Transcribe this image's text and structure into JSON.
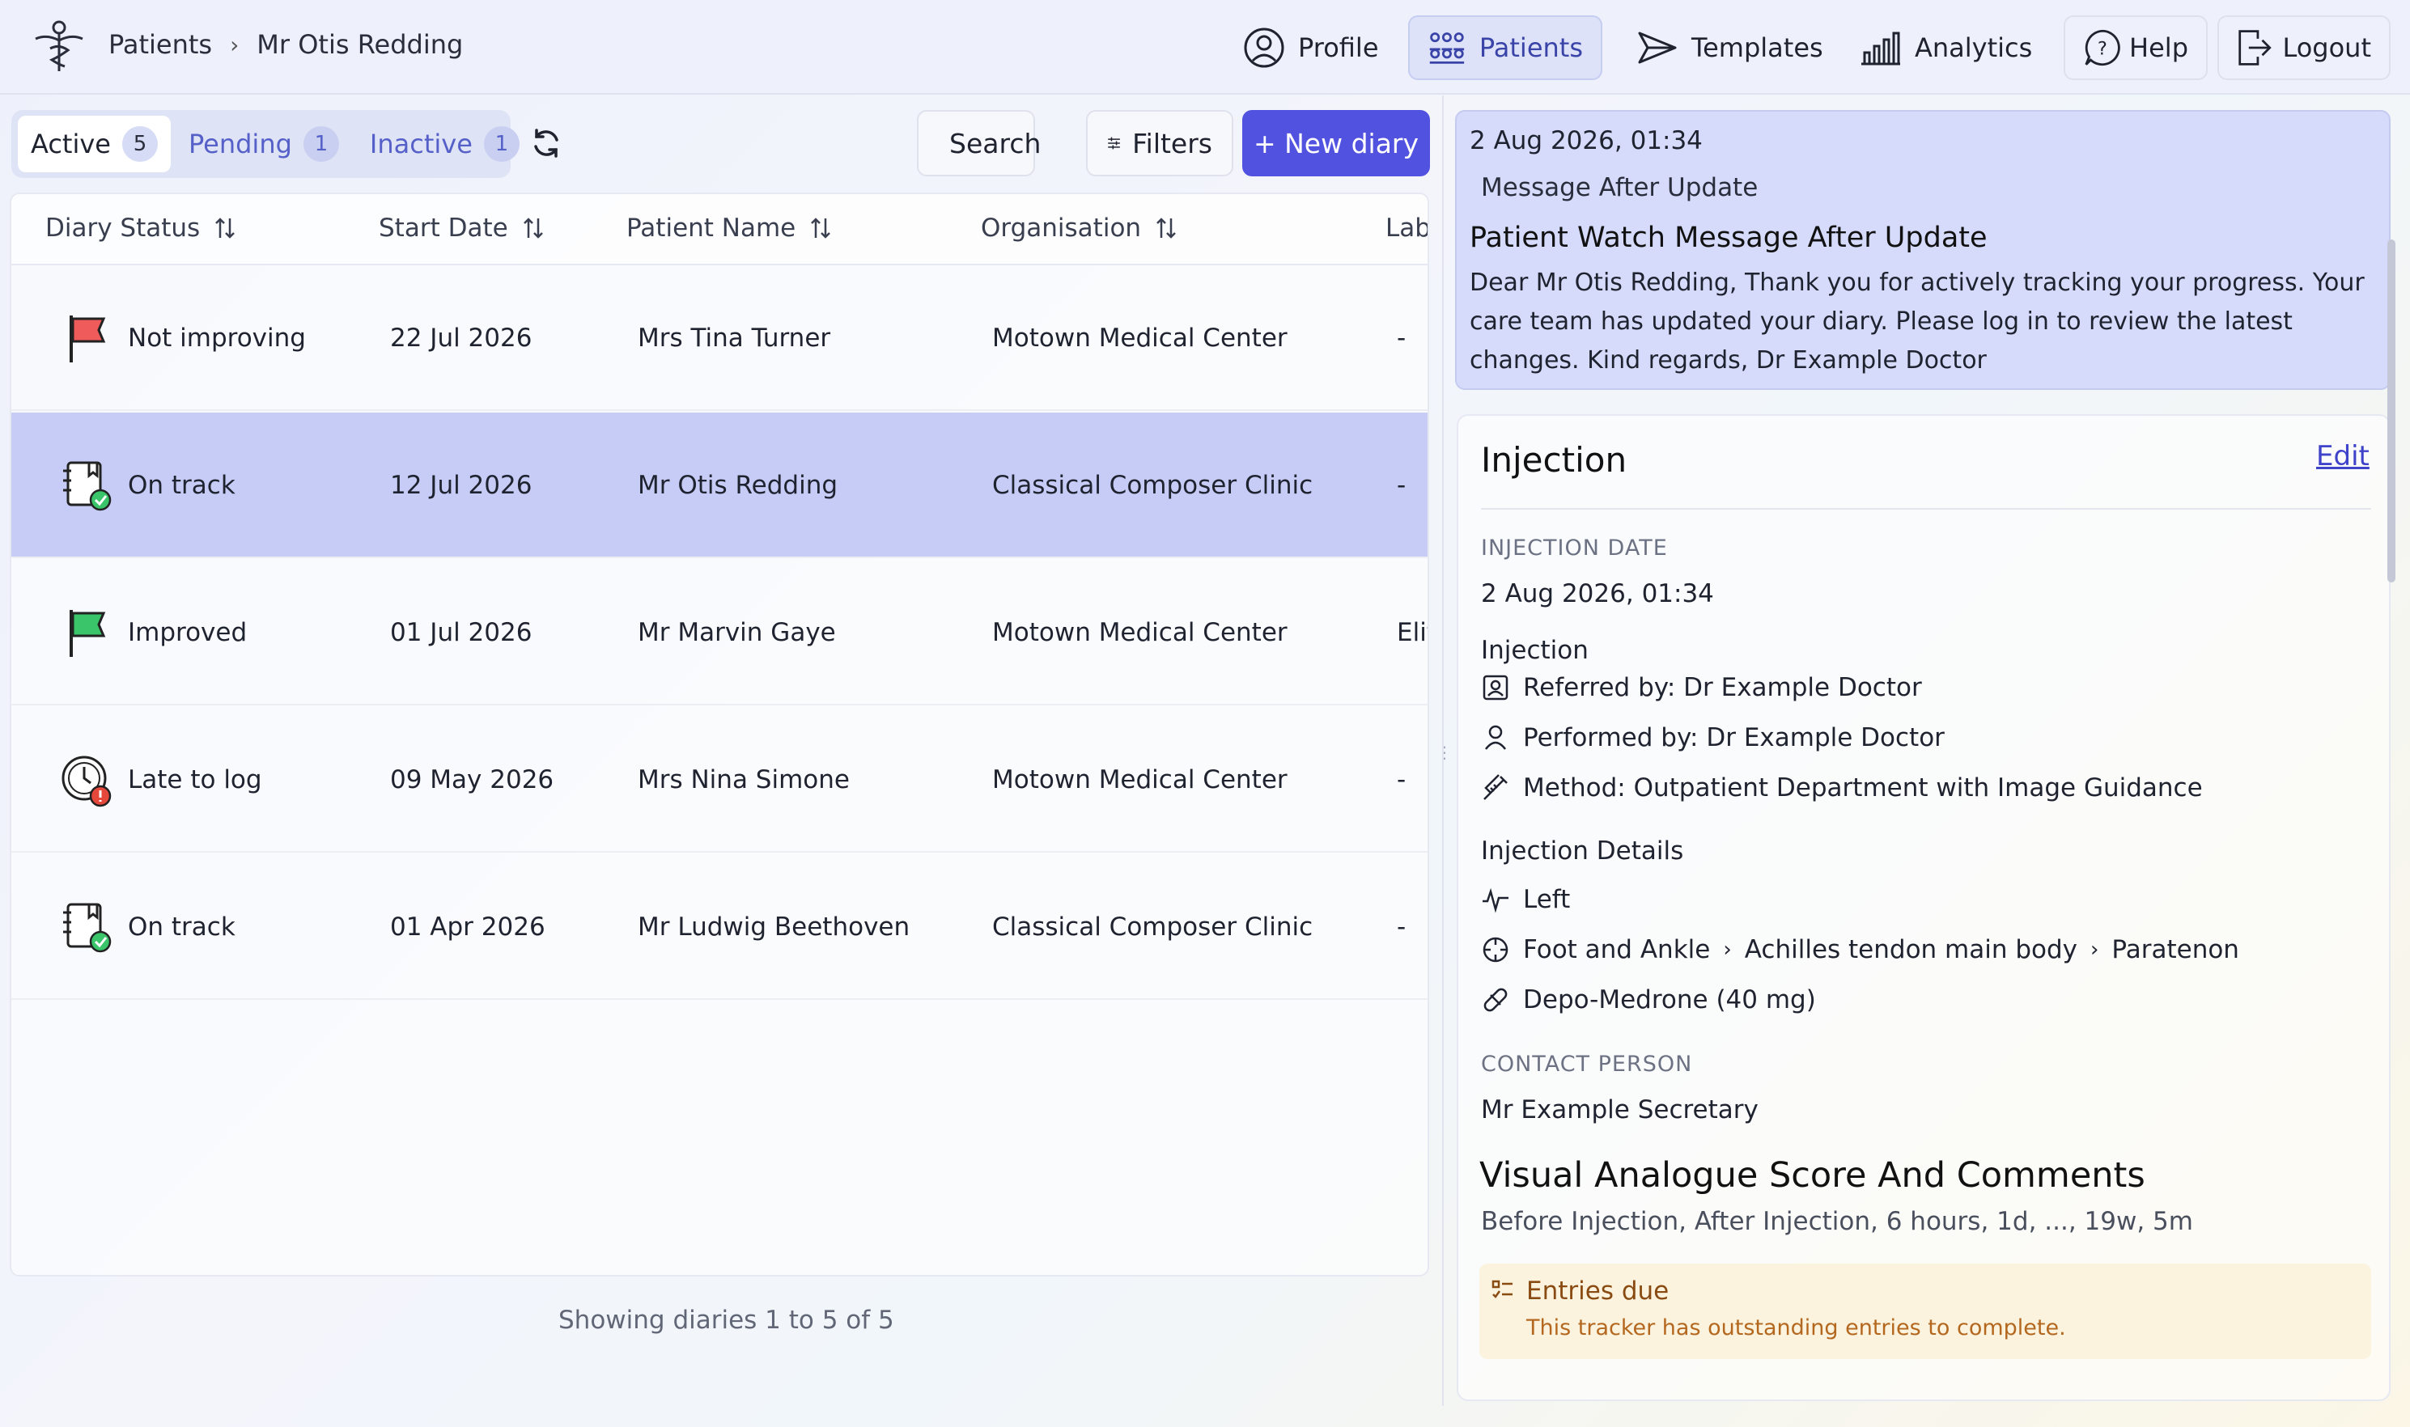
{
  "header": {
    "breadcrumb": [
      "Patients",
      "Mr Otis Redding"
    ],
    "nav": {
      "profile": "Profile",
      "patients": "Patients",
      "templates": "Templates",
      "analytics": "Analytics",
      "help": "Help",
      "logout": "Logout"
    }
  },
  "tabs": [
    {
      "label": "Active",
      "count": "5"
    },
    {
      "label": "Pending",
      "count": "1"
    },
    {
      "label": "Inactive",
      "count": "1"
    }
  ],
  "toolbar": {
    "search": "Search",
    "filters": "Filters",
    "new_diary": "+ New diary"
  },
  "table": {
    "columns": [
      "Diary Status",
      "Start Date",
      "Patient Name",
      "Organisation",
      "Lab"
    ],
    "rows": [
      {
        "status": "Not improving",
        "status_icon": "red-flag-icon",
        "start": "22 Jul 2026",
        "patient": "Mrs Tina Turner",
        "org": "Motown Medical Center",
        "lab": "-"
      },
      {
        "status": "On track",
        "status_icon": "diary-check-icon",
        "start": "12 Jul 2026",
        "patient": "Mr Otis Redding",
        "org": "Classical Composer Clinic",
        "lab": "-"
      },
      {
        "status": "Improved",
        "status_icon": "green-flag-icon",
        "start": "01 Jul 2026",
        "patient": "Mr Marvin Gaye",
        "org": "Motown Medical Center",
        "lab": "Elit"
      },
      {
        "status": "Late to log",
        "status_icon": "clock-alert-icon",
        "start": "09 May 2026",
        "patient": "Mrs Nina Simone",
        "org": "Motown Medical Center",
        "lab": "-"
      },
      {
        "status": "On track",
        "status_icon": "diary-check-icon",
        "start": "01 Apr 2026",
        "patient": "Mr Ludwig Beethoven",
        "org": "Classical Composer Clinic",
        "lab": "-"
      }
    ],
    "footer": "Showing diaries 1 to 5 of 5"
  },
  "message": {
    "date": "2 Aug 2026, 01:34",
    "subtitle": "Message After Update",
    "title": "Patient Watch Message After Update",
    "body": "Dear Mr Otis Redding, Thank you for actively tracking your progress. Your care team has updated your diary. Please log in to review the latest changes. Kind regards, Dr Example Doctor"
  },
  "injection": {
    "title": "Injection",
    "edit": "Edit",
    "date_label": "INJECTION DATE",
    "date_value": "2 Aug 2026, 01:34",
    "section_label": "Injection",
    "referred_by": "Referred by: Dr Example Doctor",
    "performed_by": "Performed by: Dr Example Doctor",
    "method": "Method: Outpatient Department with Image Guidance",
    "details_label": "Injection Details",
    "side": "Left",
    "site": [
      "Foot and Ankle",
      "Achilles tendon main body",
      "Paratenon"
    ],
    "drug": "Depo-Medrone (40 mg)",
    "contact_label": "CONTACT PERSON",
    "contact_value": "Mr Example Secretary"
  },
  "vas": {
    "title": "Visual Analogue Score And Comments",
    "subtitle": "Before Injection, After Injection, 6 hours, 1d, ..., 19w, 5m",
    "due_title": "Entries due",
    "due_text": "This tracker has outstanding entries to complete."
  },
  "colors": {
    "accent": "#5252e0",
    "selected_row": "#c6ccf5",
    "flag_red": "#ef5a5a",
    "flag_green": "#3bc56a",
    "due_bg": "#fbf3dd"
  }
}
